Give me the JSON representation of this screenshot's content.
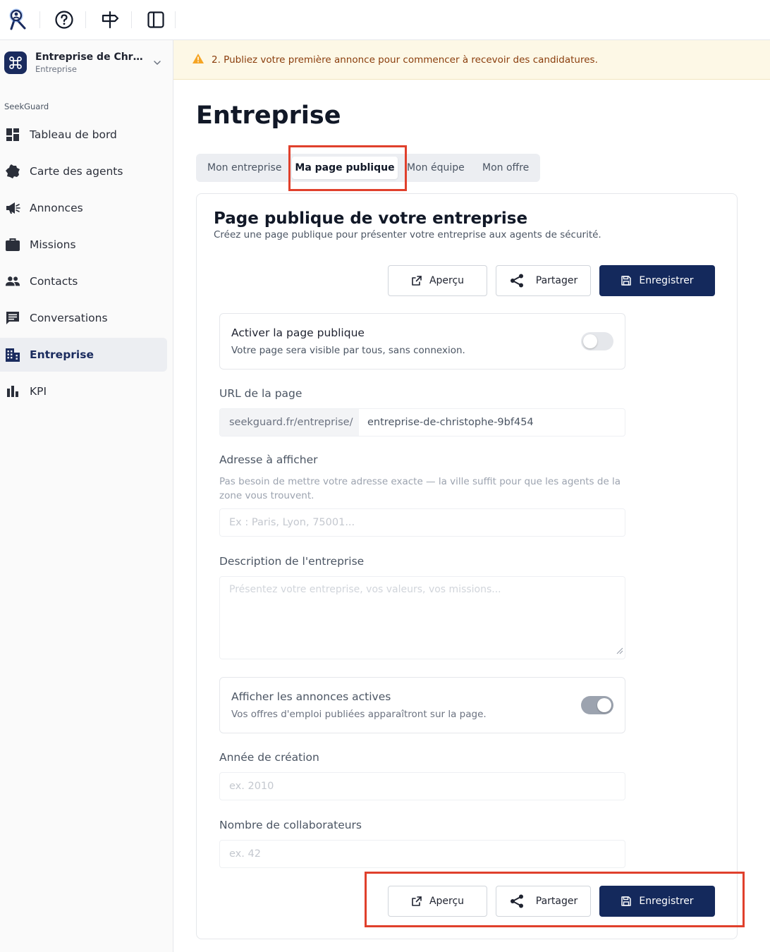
{
  "colors": {
    "brand_navy": "#14295c",
    "highlight_red": "#e0402c",
    "banner_bg": "#fdf8e6",
    "banner_text": "#8a3d0c",
    "warning_icon": "#f5a524"
  },
  "topbar": {
    "icons": [
      "seekguard-logo-icon",
      "help-circle-icon",
      "signpost-icon",
      "sidebar-toggle-icon"
    ]
  },
  "sidebar": {
    "org_name": "Entreprise de Christ...",
    "org_sub": "Entreprise",
    "section": "SeekGuard",
    "items": [
      {
        "label": "Tableau de bord",
        "icon": "dashboard-icon"
      },
      {
        "label": "Carte des agents",
        "icon": "france-map-icon"
      },
      {
        "label": "Annonces",
        "icon": "megaphone-icon"
      },
      {
        "label": "Missions",
        "icon": "briefcase-icon"
      },
      {
        "label": "Contacts",
        "icon": "people-icon"
      },
      {
        "label": "Conversations",
        "icon": "chat-icon"
      },
      {
        "label": "Entreprise",
        "icon": "building-icon",
        "active": true
      },
      {
        "label": "KPI",
        "icon": "bar-chart-icon"
      }
    ]
  },
  "banner": {
    "text": "2. Publiez votre première annonce pour commencer à recevoir des candidatures."
  },
  "main": {
    "title": "Entreprise",
    "tabs": [
      {
        "label": "Mon entreprise"
      },
      {
        "label": "Ma page publique",
        "active": true
      },
      {
        "label": "Mon équipe"
      },
      {
        "label": "Mon offre"
      }
    ]
  },
  "card": {
    "title": "Page publique de votre entreprise",
    "subtitle": "Créez une page publique pour présenter votre entreprise aux agents de sécurité.",
    "actions": {
      "preview": "Aperçu",
      "share": "Partager",
      "save": "Enregistrer"
    },
    "public_toggle": {
      "title": "Activer la page publique",
      "desc": "Votre page sera visible par tous, sans connexion.",
      "on": false
    },
    "url": {
      "label": "URL de la page",
      "prefix": "seekguard.fr/entreprise/",
      "value": "entreprise-de-christophe-9bf454"
    },
    "address": {
      "label": "Adresse à afficher",
      "help": "Pas besoin de mettre votre adresse exacte — la ville suffit pour que les agents de la zone vous trouvent.",
      "placeholder": "Ex : Paris, Lyon, 75001..."
    },
    "description": {
      "label": "Description de l'entreprise",
      "placeholder": "Présentez votre entreprise, vos valeurs, vos missions..."
    },
    "ads_toggle": {
      "title": "Afficher les annonces actives",
      "desc": "Vos offres d'emploi publiées apparaîtront sur la page.",
      "on": true
    },
    "year": {
      "label": "Année de création",
      "placeholder": "ex. 2010"
    },
    "staff": {
      "label": "Nombre de collaborateurs",
      "placeholder": "ex. 42"
    }
  }
}
